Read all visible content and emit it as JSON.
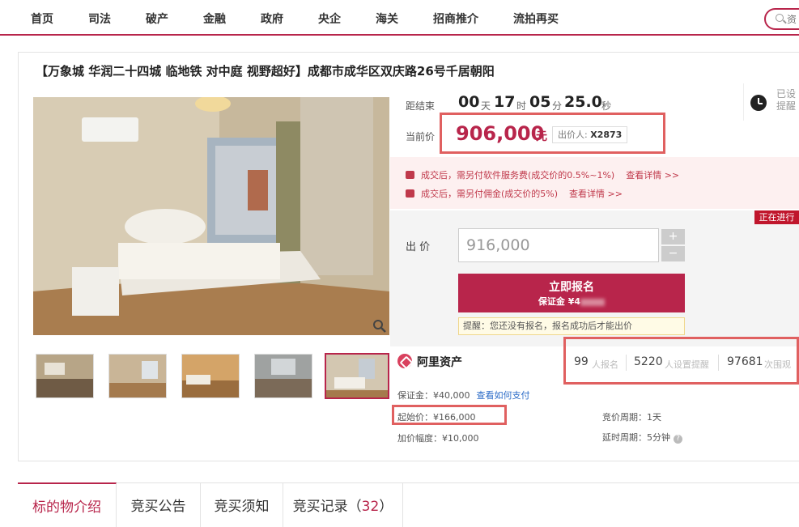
{
  "nav": {
    "items": [
      "首页",
      "司法",
      "破产",
      "金融",
      "政府",
      "央企",
      "海关",
      "招商推介",
      "流拍再买"
    ],
    "search_placeholder": "资"
  },
  "listing": {
    "title": "【万象城 华润二十四城 临地铁 对中庭 视野超好】成都市成华区双庆路26号千居朝阳"
  },
  "countdown": {
    "label": "距结束",
    "days": "00",
    "days_unit": "天",
    "hours": "17",
    "hours_unit": "时",
    "minutes": "05",
    "minutes_unit": "分",
    "seconds": "25.0",
    "seconds_unit": "秒"
  },
  "current_price": {
    "label": "当前价",
    "value": "906,000",
    "unit": "元",
    "bidder_label": "出价人:",
    "bidder_id": "X2873"
  },
  "remind": {
    "text": "已设提醒"
  },
  "fees": [
    {
      "text": "成交后，需另付软件服务费(成交价的0.5%~1%)",
      "link": "查看详情 >>"
    },
    {
      "text": "成交后，需另付佣金(成交价的5%)",
      "link": "查看详情 >>"
    }
  ],
  "status_tag": "正在进行",
  "bid": {
    "label": "出 价",
    "value": "916,000",
    "plus": "+",
    "minus": "−",
    "register_button": "立即报名",
    "deposit_prefix": "保证金 ¥4",
    "tip": "提醒：您还没有报名，报名成功后才能出价"
  },
  "provider": {
    "name": "阿里资产"
  },
  "stats": {
    "registered_count": "99",
    "registered_label": "人报名",
    "reminders_count": "5220",
    "reminders_label": "人设置提醒",
    "views_count": "97681",
    "views_label": "次围观"
  },
  "details": {
    "deposit": "保证金：¥40,000",
    "pay_link": "查看如何支付",
    "start_price": "起始价：¥166,000",
    "increment": "加价幅度：¥10,000",
    "bid_cycle": "竞价周期：1天",
    "delay_cycle": "延时周期：5分钟"
  },
  "tabs": [
    {
      "label": "标的物介绍"
    },
    {
      "label": "竞买公告"
    },
    {
      "label": "竞买须知"
    },
    {
      "label": "竞买记录（",
      "count": "32",
      "suffix": "）"
    }
  ],
  "colors": {
    "accent": "#b8254b",
    "highlight_box": "#e06060"
  }
}
